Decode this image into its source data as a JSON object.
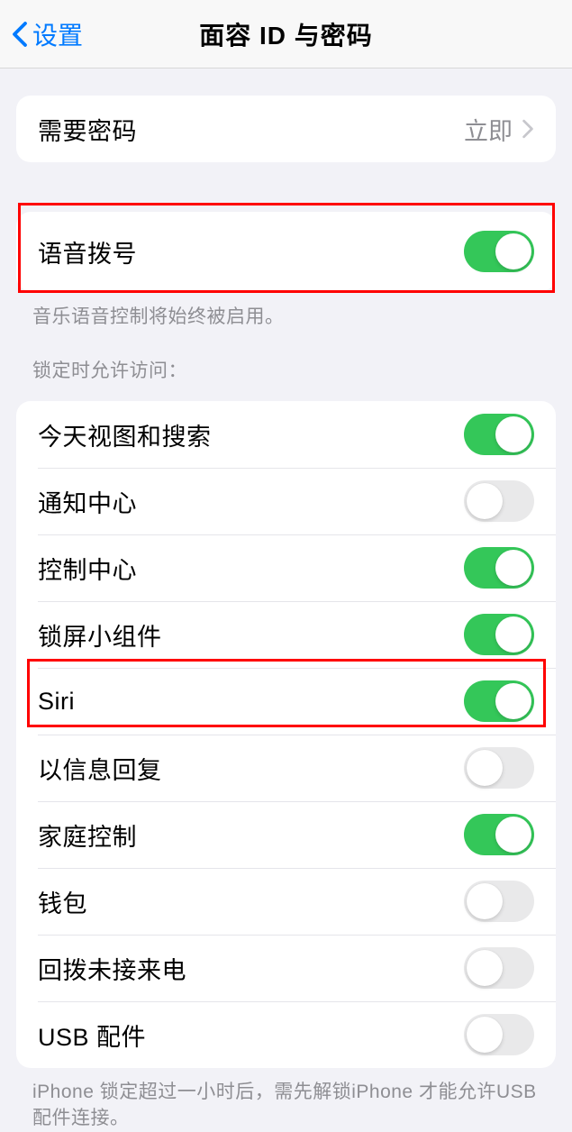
{
  "nav": {
    "back_label": "设置",
    "title": "面容 ID 与密码"
  },
  "group1": {
    "items": [
      {
        "label": "需要密码",
        "value": "立即",
        "type": "disclosure"
      }
    ]
  },
  "group2": {
    "items": [
      {
        "label": "语音拨号",
        "on": true
      }
    ],
    "footer": "音乐语音控制将始终被启用。"
  },
  "group3": {
    "header": "锁定时允许访问：",
    "items": [
      {
        "label": "今天视图和搜索",
        "on": true
      },
      {
        "label": "通知中心",
        "on": false
      },
      {
        "label": "控制中心",
        "on": true
      },
      {
        "label": "锁屏小组件",
        "on": true
      },
      {
        "label": "Siri",
        "on": true
      },
      {
        "label": "以信息回复",
        "on": false
      },
      {
        "label": "家庭控制",
        "on": true
      },
      {
        "label": "钱包",
        "on": false
      },
      {
        "label": "回拨未接来电",
        "on": false
      },
      {
        "label": "USB 配件",
        "on": false
      }
    ],
    "footer": "iPhone 锁定超过一小时后，需先解锁iPhone 才能允许USB 配件连接。"
  }
}
